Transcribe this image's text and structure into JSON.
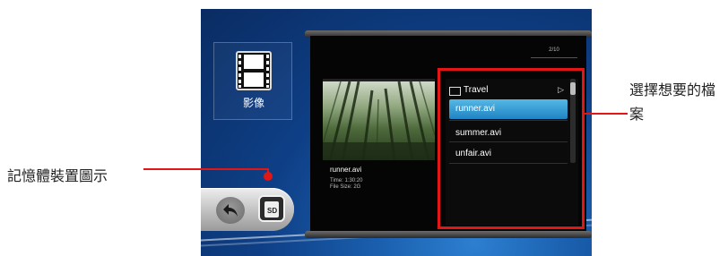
{
  "category": {
    "label": "影像",
    "icon": "film-icon"
  },
  "browser": {
    "page_counter": "2/10",
    "folder": {
      "name": "Travel"
    },
    "files": [
      {
        "name": "runner.avi",
        "selected": true
      },
      {
        "name": "summer.avi",
        "selected": false
      },
      {
        "name": "unfair.avi",
        "selected": false
      }
    ]
  },
  "preview": {
    "file_name": "runner.avi",
    "time": "Time: 1:30:20",
    "size": "File Size: 2G"
  },
  "storage": {
    "sd_label": "SD"
  },
  "annotations": {
    "select_file": "選擇想要的檔案",
    "memory_icon": "記憶體裝置圖示"
  },
  "colors": {
    "highlight": "#e31616",
    "selection": "#2b93cf"
  }
}
